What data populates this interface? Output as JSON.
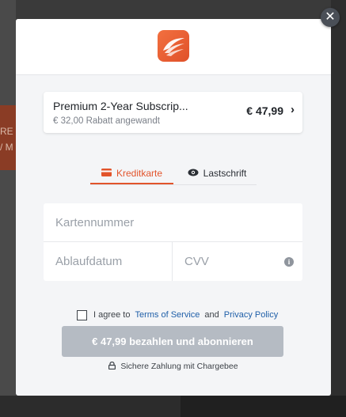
{
  "background": {
    "side_text": "RE F\n/ M"
  },
  "modal": {
    "close_symbol": "✕",
    "plan": {
      "name": "Premium 2-Year Subscrip...",
      "discount": "€ 32,00 Rabatt angewandt",
      "price": "€ 47,99",
      "chevron": "›"
    },
    "tabs": [
      {
        "label": "Kreditkarte",
        "icon": "credit-card-icon",
        "active": true
      },
      {
        "label": "Lastschrift",
        "icon": "eye-icon",
        "active": false
      }
    ],
    "form": {
      "card_number_placeholder": "Kartennummer",
      "expiry_placeholder": "Ablaufdatum",
      "cvv_placeholder": "CVV",
      "info_symbol": "i"
    },
    "agree": {
      "prefix": "I agree to",
      "terms_link": "Terms of Service",
      "and": "and",
      "privacy_link": "Privacy Policy"
    },
    "pay_button": "€ 47,99 bezahlen und abonnieren",
    "secure_note": "Sichere Zahlung mit Chargebee"
  },
  "colors": {
    "accent": "#e2542b",
    "link": "#1f5fa8",
    "button_disabled": "#b5bbc3"
  }
}
